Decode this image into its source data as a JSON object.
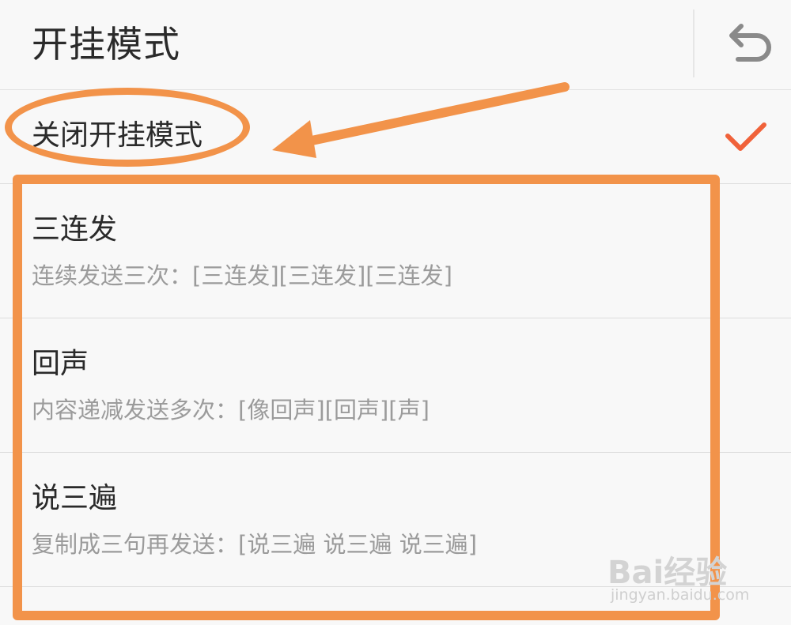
{
  "header": {
    "title": "开挂模式",
    "back_icon": "back-arrow-icon"
  },
  "options": [
    {
      "title": "关闭开挂模式",
      "selected": true
    },
    {
      "title": "三连发",
      "subtitle": "连续发送三次：[三连发][三连发][三连发]"
    },
    {
      "title": "回声",
      "subtitle": "内容递减发送多次：[像回声][回声][声]"
    },
    {
      "title": "说三遍",
      "subtitle": "复制成三句再发送：[说三遍 说三遍 说三遍]"
    }
  ],
  "colors": {
    "accent": "#f0623a",
    "annotation": "#f2934a",
    "background": "#f8f8f8"
  },
  "watermark": {
    "brand": "Bai经验",
    "url": "jingyan.baidu.com"
  }
}
